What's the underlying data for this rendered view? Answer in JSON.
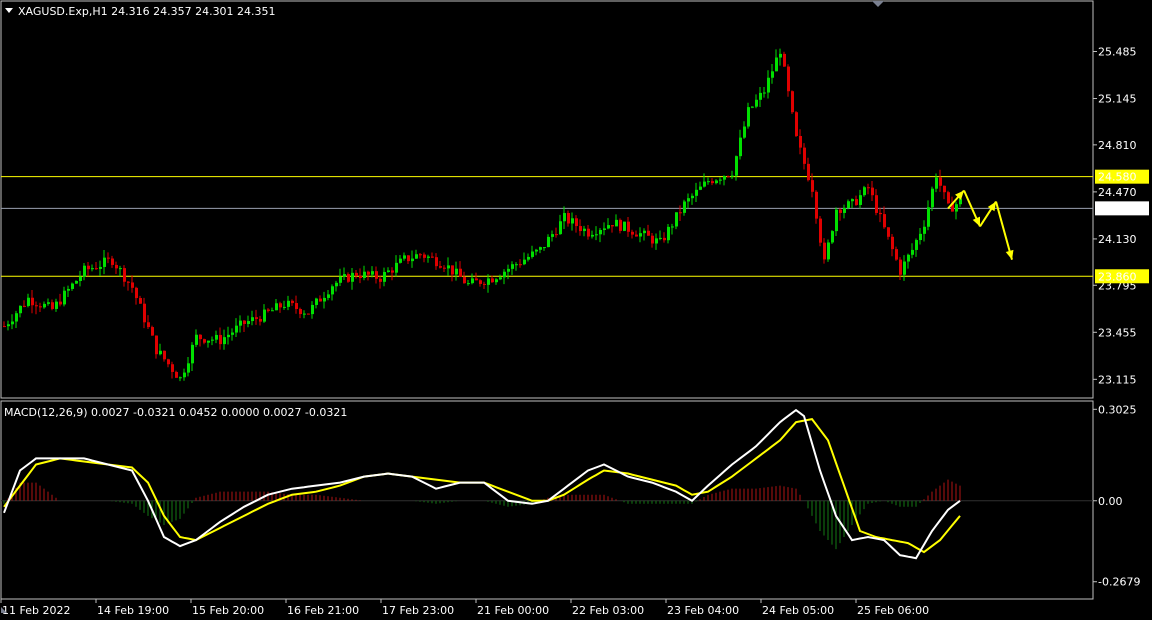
{
  "header": {
    "symbol_line": "XAGUSD.Exp,H1  24.316 24.357 24.301 24.351",
    "macd_line": "MACD(12,26,9) 0.0027 -0.0321 0.0452 0.0000 0.0027 -0.0321"
  },
  "colors": {
    "background": "#000000",
    "frame": "#c0c0c0",
    "bull": "#00e000",
    "bear": "#e00000",
    "level": "#ffff00",
    "current": "#9aa0b0",
    "macd_main": "#ffffff",
    "macd_signal": "#ffff00",
    "arrow": "#ffff00"
  },
  "chart_data": [
    {
      "type": "candlestick",
      "name": "price",
      "x_labels": [
        "11 Feb 2022",
        "14 Feb 19:00",
        "15 Feb 20:00",
        "16 Feb 21:00",
        "17 Feb 23:00",
        "21 Feb 00:00",
        "22 Feb 03:00",
        "23 Feb 04:00",
        "24 Feb 05:00",
        "25 Feb 06:00"
      ],
      "y_ticks": [
        "25.485",
        "25.145",
        "24.810",
        "24.470",
        "24.130",
        "23.795",
        "23.455",
        "23.115"
      ],
      "ylim": [
        22.98,
        25.85
      ],
      "horizontal_levels": [
        {
          "label": "24.580",
          "value": 24.58
        },
        {
          "label": "23.860",
          "value": 23.86
        }
      ],
      "current_price": {
        "label": "24.351",
        "value": 24.351
      },
      "path_points": [
        [
          0,
          23.5
        ],
        [
          6,
          23.7
        ],
        [
          12,
          23.62
        ],
        [
          20,
          23.9
        ],
        [
          27,
          23.98
        ],
        [
          32,
          23.78
        ],
        [
          38,
          23.33
        ],
        [
          44,
          23.12
        ],
        [
          48,
          23.42
        ],
        [
          54,
          23.4
        ],
        [
          60,
          23.52
        ],
        [
          65,
          23.58
        ],
        [
          70,
          23.66
        ],
        [
          76,
          23.6
        ],
        [
          82,
          23.8
        ],
        [
          88,
          23.88
        ],
        [
          94,
          23.85
        ],
        [
          100,
          23.98
        ],
        [
          104,
          24.02
        ],
        [
          110,
          23.95
        ],
        [
          116,
          23.8
        ],
        [
          122,
          23.85
        ],
        [
          128,
          23.95
        ],
        [
          134,
          24.05
        ],
        [
          140,
          24.28
        ],
        [
          146,
          24.18
        ],
        [
          152,
          24.25
        ],
        [
          158,
          24.18
        ],
        [
          164,
          24.1
        ],
        [
          170,
          24.38
        ],
        [
          176,
          24.55
        ],
        [
          182,
          24.62
        ],
        [
          186,
          25.05
        ],
        [
          190,
          25.2
        ],
        [
          194,
          25.5
        ],
        [
          198,
          24.85
        ],
        [
          202,
          24.5
        ],
        [
          205,
          23.95
        ],
        [
          208,
          24.35
        ],
        [
          212,
          24.38
        ],
        [
          216,
          24.5
        ],
        [
          220,
          24.2
        ],
        [
          224,
          23.9
        ],
        [
          227,
          24.05
        ],
        [
          230,
          24.25
        ],
        [
          233,
          24.6
        ],
        [
          236,
          24.35
        ],
        [
          239,
          24.4
        ]
      ],
      "forecast_arrows": [
        [
          [
            236,
            24.35
          ],
          [
            240,
            24.48
          ]
        ],
        [
          [
            240,
            24.48
          ],
          [
            244,
            24.22
          ]
        ],
        [
          [
            244,
            24.22
          ],
          [
            248,
            24.4
          ]
        ],
        [
          [
            248,
            24.4
          ],
          [
            252,
            23.98
          ]
        ]
      ]
    },
    {
      "type": "macd",
      "name": "MACD(12,26,9)",
      "y_ticks": [
        "0.3025",
        "0.00",
        "-0.2679"
      ],
      "ylim": [
        -0.325,
        0.33
      ],
      "main_points": [
        [
          0,
          -0.04
        ],
        [
          4,
          0.1
        ],
        [
          8,
          0.14
        ],
        [
          14,
          0.14
        ],
        [
          20,
          0.14
        ],
        [
          26,
          0.12
        ],
        [
          32,
          0.1
        ],
        [
          36,
          0.0
        ],
        [
          40,
          -0.12
        ],
        [
          44,
          -0.15
        ],
        [
          48,
          -0.13
        ],
        [
          54,
          -0.07
        ],
        [
          60,
          -0.02
        ],
        [
          66,
          0.02
        ],
        [
          72,
          0.04
        ],
        [
          78,
          0.05
        ],
        [
          84,
          0.06
        ],
        [
          90,
          0.08
        ],
        [
          96,
          0.09
        ],
        [
          102,
          0.08
        ],
        [
          108,
          0.04
        ],
        [
          114,
          0.06
        ],
        [
          120,
          0.06
        ],
        [
          126,
          0.0
        ],
        [
          132,
          -0.01
        ],
        [
          136,
          0.0
        ],
        [
          140,
          0.04
        ],
        [
          146,
          0.1
        ],
        [
          150,
          0.12
        ],
        [
          156,
          0.08
        ],
        [
          162,
          0.06
        ],
        [
          168,
          0.03
        ],
        [
          172,
          0.0
        ],
        [
          176,
          0.05
        ],
        [
          182,
          0.12
        ],
        [
          188,
          0.18
        ],
        [
          194,
          0.26
        ],
        [
          198,
          0.3
        ],
        [
          200,
          0.28
        ],
        [
          204,
          0.1
        ],
        [
          208,
          -0.05
        ],
        [
          212,
          -0.13
        ],
        [
          216,
          -0.12
        ],
        [
          220,
          -0.13
        ],
        [
          224,
          -0.18
        ],
        [
          228,
          -0.19
        ],
        [
          232,
          -0.1
        ],
        [
          236,
          -0.03
        ],
        [
          239,
          0.0
        ]
      ],
      "signal_points": [
        [
          0,
          -0.02
        ],
        [
          4,
          0.05
        ],
        [
          8,
          0.12
        ],
        [
          14,
          0.14
        ],
        [
          20,
          0.13
        ],
        [
          26,
          0.12
        ],
        [
          32,
          0.11
        ],
        [
          36,
          0.06
        ],
        [
          40,
          -0.05
        ],
        [
          44,
          -0.12
        ],
        [
          48,
          -0.13
        ],
        [
          54,
          -0.09
        ],
        [
          60,
          -0.05
        ],
        [
          66,
          -0.01
        ],
        [
          72,
          0.02
        ],
        [
          78,
          0.03
        ],
        [
          84,
          0.05
        ],
        [
          90,
          0.08
        ],
        [
          96,
          0.09
        ],
        [
          102,
          0.08
        ],
        [
          108,
          0.07
        ],
        [
          114,
          0.06
        ],
        [
          120,
          0.06
        ],
        [
          126,
          0.03
        ],
        [
          132,
          0.0
        ],
        [
          136,
          0.0
        ],
        [
          140,
          0.02
        ],
        [
          146,
          0.07
        ],
        [
          150,
          0.1
        ],
        [
          156,
          0.09
        ],
        [
          162,
          0.07
        ],
        [
          168,
          0.05
        ],
        [
          172,
          0.02
        ],
        [
          176,
          0.03
        ],
        [
          182,
          0.08
        ],
        [
          188,
          0.14
        ],
        [
          194,
          0.2
        ],
        [
          198,
          0.26
        ],
        [
          202,
          0.27
        ],
        [
          206,
          0.2
        ],
        [
          210,
          0.05
        ],
        [
          214,
          -0.1
        ],
        [
          218,
          -0.12
        ],
        [
          222,
          -0.13
        ],
        [
          226,
          -0.14
        ],
        [
          230,
          -0.17
        ],
        [
          234,
          -0.13
        ],
        [
          239,
          -0.05
        ]
      ],
      "hist_points": [
        [
          0,
          -0.01
        ],
        [
          4,
          0.06
        ],
        [
          8,
          0.06
        ],
        [
          14,
          0.0
        ],
        [
          20,
          0.0
        ],
        [
          26,
          0.0
        ],
        [
          32,
          -0.01
        ],
        [
          36,
          -0.05
        ],
        [
          40,
          -0.08
        ],
        [
          44,
          -0.06
        ],
        [
          48,
          0.01
        ],
        [
          54,
          0.03
        ],
        [
          60,
          0.03
        ],
        [
          66,
          0.03
        ],
        [
          72,
          0.02
        ],
        [
          78,
          0.02
        ],
        [
          84,
          0.01
        ],
        [
          90,
          0.0
        ],
        [
          96,
          0.0
        ],
        [
          102,
          0.0
        ],
        [
          108,
          -0.01
        ],
        [
          114,
          0.0
        ],
        [
          120,
          0.0
        ],
        [
          126,
          -0.02
        ],
        [
          132,
          -0.01
        ],
        [
          136,
          0.01
        ],
        [
          140,
          0.02
        ],
        [
          146,
          0.02
        ],
        [
          150,
          0.02
        ],
        [
          156,
          -0.01
        ],
        [
          162,
          -0.01
        ],
        [
          168,
          -0.01
        ],
        [
          172,
          -0.01
        ],
        [
          176,
          0.02
        ],
        [
          182,
          0.04
        ],
        [
          188,
          0.04
        ],
        [
          194,
          0.05
        ],
        [
          198,
          0.04
        ],
        [
          200,
          0.0
        ],
        [
          204,
          -0.1
        ],
        [
          208,
          -0.16
        ],
        [
          212,
          -0.08
        ],
        [
          216,
          -0.01
        ],
        [
          220,
          0.0
        ],
        [
          224,
          -0.02
        ],
        [
          228,
          -0.02
        ],
        [
          232,
          0.03
        ],
        [
          236,
          0.07
        ],
        [
          239,
          0.05
        ]
      ]
    }
  ]
}
